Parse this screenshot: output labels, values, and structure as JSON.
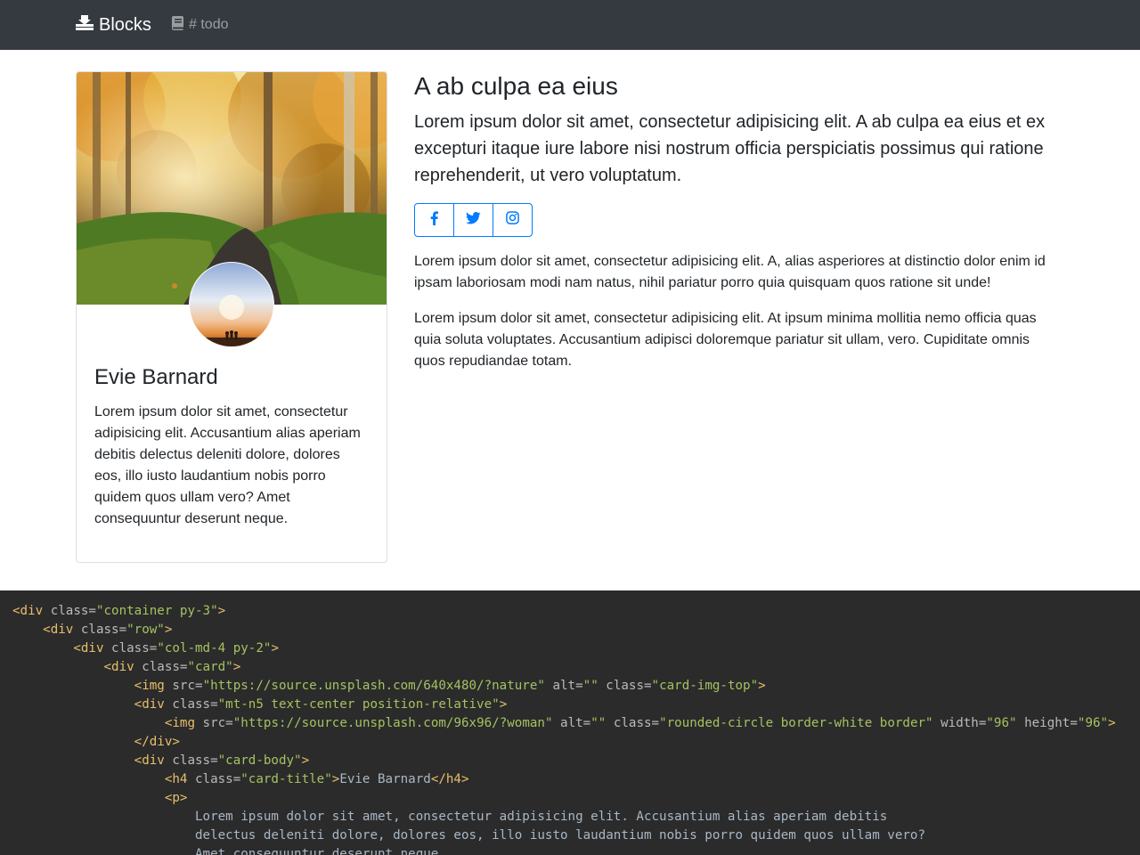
{
  "navbar": {
    "brand_icon": "inbox-tray-icon",
    "brand": "Blocks",
    "link_icon": "book-icon",
    "link": "# todo",
    "background": "#343a40"
  },
  "card": {
    "image_alt": "forest path in autumn",
    "avatar_alt": "people silhouetted at sunset",
    "title": "Evie Barnard",
    "text": "Lorem ipsum dolor sit amet, consectetur adipisicing elit. Accusantium alias aperiam debitis delectus deleniti dolore, dolores eos, illo iusto laudantium nobis porro quidem quos ullam vero? Amet consequuntur deserunt neque."
  },
  "main": {
    "title": "A ab culpa ea eius",
    "lead": "Lorem ipsum dolor sit amet, consectetur adipisicing elit. A ab culpa ea eius et ex excepturi itaque iure labore nisi nostrum officia perspiciatis possimus qui ratione reprehenderit, ut vero voluptatum.",
    "social": [
      {
        "icon": "facebook-icon"
      },
      {
        "icon": "twitter-icon"
      },
      {
        "icon": "instagram-icon"
      }
    ],
    "paragraph1": "Lorem ipsum dolor sit amet, consectetur adipisicing elit. A, alias asperiores at distinctio dolor enim id ipsam laboriosam modi nam natus, nihil pariatur porro quia quisquam quos ratione sit unde!",
    "paragraph2": "Lorem ipsum dolor sit amet, consectetur adipisicing elit. At ipsum minima mollitia nemo officia quas quia soluta voluptates. Accusantium adipisci doloremque pariatur sit ullam, vero. Cupiditate omnis quos repudiandae totam.",
    "accent": "#007bff"
  },
  "code": {
    "background": "#2b2b2b",
    "lines": [
      [
        {
          "t": "tag",
          "s": "<div"
        },
        {
          "t": "attr",
          "s": " class="
        },
        {
          "t": "val",
          "s": "\"container py-3\""
        },
        {
          "t": "tag",
          "s": ">"
        }
      ],
      [
        {
          "t": "txt",
          "s": "    "
        },
        {
          "t": "tag",
          "s": "<div"
        },
        {
          "t": "attr",
          "s": " class="
        },
        {
          "t": "val",
          "s": "\"row\""
        },
        {
          "t": "tag",
          "s": ">"
        }
      ],
      [
        {
          "t": "txt",
          "s": "        "
        },
        {
          "t": "tag",
          "s": "<div"
        },
        {
          "t": "attr",
          "s": " class="
        },
        {
          "t": "val",
          "s": "\"col-md-4 py-2\""
        },
        {
          "t": "tag",
          "s": ">"
        }
      ],
      [
        {
          "t": "txt",
          "s": "            "
        },
        {
          "t": "tag",
          "s": "<div"
        },
        {
          "t": "attr",
          "s": " class="
        },
        {
          "t": "val",
          "s": "\"card\""
        },
        {
          "t": "tag",
          "s": ">"
        }
      ],
      [
        {
          "t": "txt",
          "s": "                "
        },
        {
          "t": "tag",
          "s": "<img"
        },
        {
          "t": "attr",
          "s": " src="
        },
        {
          "t": "val",
          "s": "\"https://source.unsplash.com/640x480/?nature\""
        },
        {
          "t": "attr",
          "s": " alt="
        },
        {
          "t": "val",
          "s": "\"\""
        },
        {
          "t": "attr",
          "s": " class="
        },
        {
          "t": "val",
          "s": "\"card-img-top\""
        },
        {
          "t": "tag",
          "s": ">"
        }
      ],
      [
        {
          "t": "txt",
          "s": "                "
        },
        {
          "t": "tag",
          "s": "<div"
        },
        {
          "t": "attr",
          "s": " class="
        },
        {
          "t": "val",
          "s": "\"mt-n5 text-center position-relative\""
        },
        {
          "t": "tag",
          "s": ">"
        }
      ],
      [
        {
          "t": "txt",
          "s": "                    "
        },
        {
          "t": "tag",
          "s": "<img"
        },
        {
          "t": "attr",
          "s": " src="
        },
        {
          "t": "val",
          "s": "\"https://source.unsplash.com/96x96/?woman\""
        },
        {
          "t": "attr",
          "s": " alt="
        },
        {
          "t": "val",
          "s": "\"\""
        },
        {
          "t": "attr",
          "s": " class="
        },
        {
          "t": "val",
          "s": "\"rounded-circle border-white border\""
        },
        {
          "t": "attr",
          "s": " width="
        },
        {
          "t": "val",
          "s": "\"96\""
        },
        {
          "t": "attr",
          "s": " height="
        },
        {
          "t": "val",
          "s": "\"96\""
        },
        {
          "t": "tag",
          "s": ">"
        }
      ],
      [
        {
          "t": "txt",
          "s": "                "
        },
        {
          "t": "tag",
          "s": "</div>"
        }
      ],
      [
        {
          "t": "txt",
          "s": "                "
        },
        {
          "t": "tag",
          "s": "<div"
        },
        {
          "t": "attr",
          "s": " class="
        },
        {
          "t": "val",
          "s": "\"card-body\""
        },
        {
          "t": "tag",
          "s": ">"
        }
      ],
      [
        {
          "t": "txt",
          "s": "                    "
        },
        {
          "t": "tag",
          "s": "<h4"
        },
        {
          "t": "attr",
          "s": " class="
        },
        {
          "t": "val",
          "s": "\"card-title\""
        },
        {
          "t": "tag",
          "s": ">"
        },
        {
          "t": "txt",
          "s": "Evie Barnard"
        },
        {
          "t": "tag",
          "s": "</h4>"
        }
      ],
      [
        {
          "t": "txt",
          "s": "                    "
        },
        {
          "t": "tag",
          "s": "<p>"
        }
      ],
      [
        {
          "t": "txt",
          "s": "                        Lorem ipsum dolor sit amet, consectetur adipisicing elit. Accusantium alias aperiam debitis"
        }
      ],
      [
        {
          "t": "txt",
          "s": "                        delectus deleniti dolore, dolores eos, illo iusto laudantium nobis porro quidem quos ullam vero?"
        }
      ],
      [
        {
          "t": "txt",
          "s": "                        Amet consequuntur deserunt neque."
        }
      ]
    ]
  }
}
